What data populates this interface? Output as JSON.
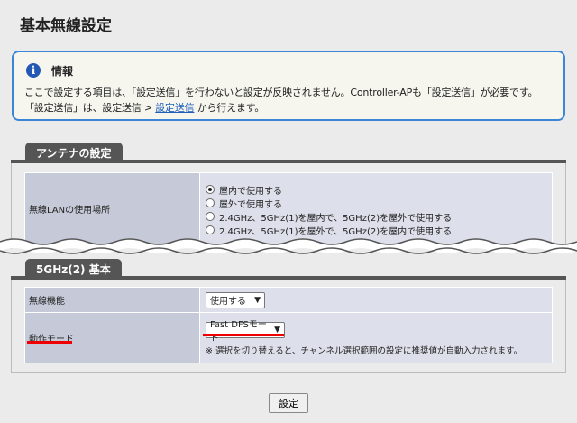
{
  "page": {
    "title": "基本無線設定"
  },
  "info": {
    "heading": "情報",
    "line1": "ここで設定する項目は、「設定送信」を行わないと設定が反映されません。Controller-APも「設定送信」が必要です。",
    "line2_prefix": "「設定送信」は、設定送信 > ",
    "line2_link": "設定送信",
    "line2_suffix": " から行えます。"
  },
  "antenna": {
    "tab": "アンテナの設定",
    "location_label": "無線LANの使用場所",
    "options": [
      {
        "label": "屋内で使用する",
        "checked": true
      },
      {
        "label": "屋外で使用する",
        "checked": false
      },
      {
        "label": "2.4GHz、5GHz(1)を屋内で、5GHz(2)を屋外で使用する",
        "checked": false
      },
      {
        "label": "2.4GHz、5GHz(1)を屋外で、5GHz(2)を屋内で使用する",
        "checked": false
      }
    ]
  },
  "band5g2": {
    "tab": "5GHz(2) 基本",
    "wireless_label": "無線機能",
    "wireless_value": "使用する",
    "mode_label": "動作モード",
    "mode_value": "Fast DFSモード",
    "hint": "※ 選択を切り替えると、チャンネル選択範囲の設定に推奨値が自動入力されます。"
  },
  "actions": {
    "submit": "設定"
  },
  "colors": {
    "accent_border": "#3b86d6",
    "highlight": "#e00000",
    "tab_bg": "#555555"
  }
}
